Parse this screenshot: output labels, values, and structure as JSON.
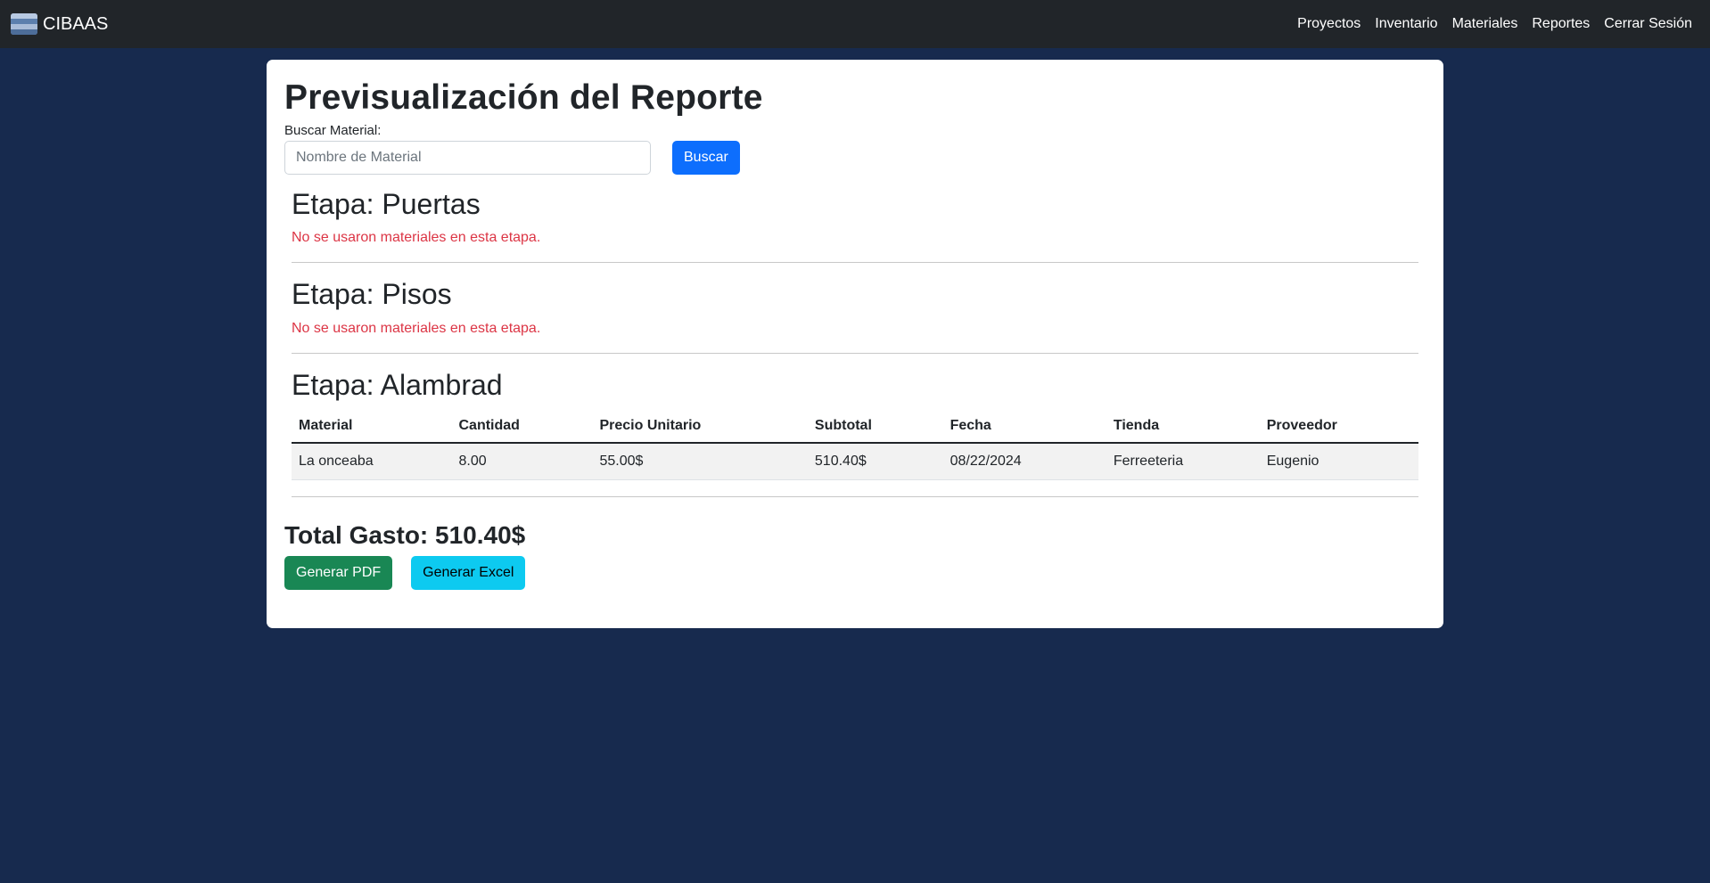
{
  "navbar": {
    "brand": "CIBAAS",
    "links": [
      "Proyectos",
      "Inventario",
      "Materiales",
      "Reportes",
      "Cerrar Sesión"
    ]
  },
  "page": {
    "title": "Previsualización del Reporte"
  },
  "search": {
    "label": "Buscar Material:",
    "placeholder": "Nombre de Material",
    "value": "",
    "button_label": "Buscar"
  },
  "stages": [
    {
      "title": "Etapa: Puertas",
      "empty_message": "No se usaron materiales en esta etapa."
    },
    {
      "title": "Etapa: Pisos",
      "empty_message": "No se usaron materiales en esta etapa."
    },
    {
      "title": "Etapa: Alambrad",
      "table": {
        "columns": [
          "Material",
          "Cantidad",
          "Precio Unitario",
          "Subtotal",
          "Fecha",
          "Tienda",
          "Proveedor"
        ],
        "rows": [
          [
            "La onceaba",
            "8.00",
            "55.00$",
            "510.40$",
            "08/22/2024",
            "Ferreeteria",
            "Eugenio"
          ]
        ]
      }
    }
  ],
  "total": {
    "label": "Total Gasto: 510.40$"
  },
  "actions": {
    "pdf_label": "Generar PDF",
    "excel_label": "Generar Excel"
  },
  "colors": {
    "background": "#172a4e",
    "navbar": "#212529",
    "primary": "#0d6efd",
    "success": "#198754",
    "info": "#0dcaf0",
    "danger": "#dc3545"
  }
}
